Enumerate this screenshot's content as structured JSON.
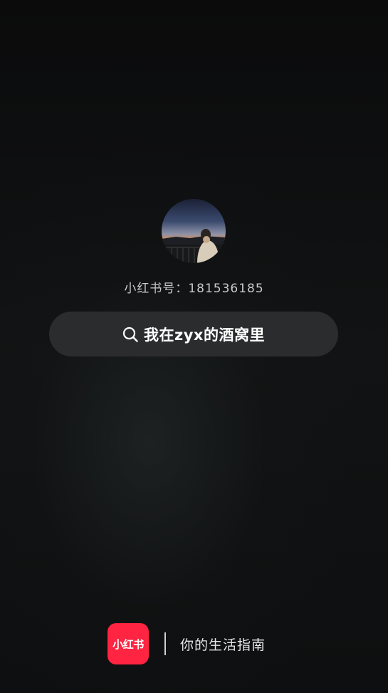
{
  "profile": {
    "avatar_icon": "profile-photo",
    "user_id": "小红书号：181536185"
  },
  "search": {
    "icon": "search-icon",
    "query": "我在zyx的酒窝里"
  },
  "brand": {
    "logo_text": "小红书",
    "slogan": "你的生活指南",
    "logo_color": "#ff2442"
  },
  "colors": {
    "background": "#0c0d0e",
    "pill": "#2b2c2d"
  }
}
